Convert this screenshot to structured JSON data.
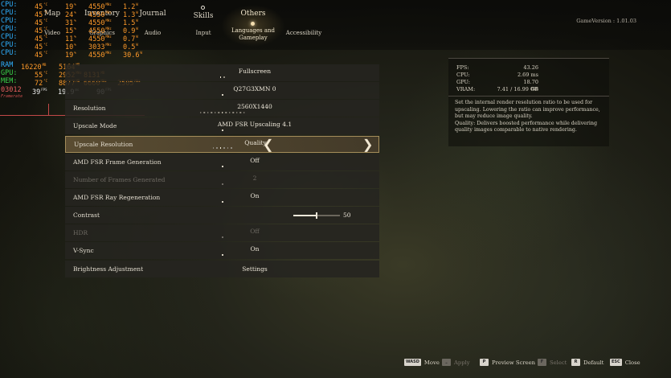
{
  "header": {
    "tabs": [
      "Map",
      "Inventory",
      "Journal",
      "Skills",
      "Others"
    ],
    "subtabs": [
      "Video",
      "Graphics",
      "Audio",
      "Input",
      "Languages and Gameplay",
      "Accessibility"
    ],
    "game_version": "GameVersion : 1.01.03"
  },
  "overlay": {
    "rows": [
      {
        "label": "CPU",
        "temp": "45",
        "load": "19",
        "clock": "4550",
        "power": "1.2"
      },
      {
        "label": "CPU",
        "temp": "45",
        "load": "24",
        "clock": "4550",
        "power": "1.3"
      },
      {
        "label": "CPU",
        "temp": "45",
        "load": "31",
        "clock": "4550",
        "power": "1.5"
      },
      {
        "label": "CPU",
        "temp": "45",
        "load": "15",
        "clock": "4550",
        "power": "0.9"
      },
      {
        "label": "CPU",
        "temp": "45",
        "load": "11",
        "clock": "4550",
        "power": "0.7"
      },
      {
        "label": "CPU",
        "temp": "45",
        "load": "10",
        "clock": "3033",
        "power": "0.5"
      },
      {
        "label": "CPU",
        "temp": "45",
        "load": "19",
        "clock": "4550",
        "power": "30.6"
      }
    ],
    "ram": {
      "label": "RAM",
      "used": "16220",
      "extra": "5164"
    },
    "gpu": {
      "label": "GPU",
      "temp": "55",
      "clock": "2952",
      "mem_clock": "8131"
    },
    "mem": {
      "label": "MEM",
      "temp": "72",
      "used": "8877",
      "clock": "6660",
      "power": "2505"
    },
    "fps_row": {
      "id": "03012",
      "fps1": "39",
      "fps2": "19.9",
      "fps3": "90",
      "frame_label": "Framerate"
    },
    "colors": {
      "label": "#2fb0ff",
      "value": "#ff9a2a",
      "graph": "#c24848"
    }
  },
  "settings": {
    "rows": [
      {
        "label": "",
        "value": "Fullscreen",
        "disabled": false
      },
      {
        "label": "",
        "value": "Q27G3XMN 0",
        "disabled": false
      },
      {
        "label": "Resolution",
        "value": "2560X1440",
        "disabled": false
      },
      {
        "label": "Upscale Mode",
        "value": "AMD FSR Upscaling 4.1",
        "disabled": false
      },
      {
        "label": "Upscale Resolution",
        "value": "Quality",
        "disabled": false,
        "selected": true
      },
      {
        "label": "AMD FSR Frame Generation",
        "value": "Off",
        "disabled": false
      },
      {
        "label": "Number of Frames Generated",
        "value": "2",
        "disabled": true
      },
      {
        "label": "AMD FSR Ray Regeneration",
        "value": "On",
        "disabled": false
      },
      {
        "label": "Contrast",
        "value": "50",
        "disabled": false,
        "slider": 0.5
      },
      {
        "label": "HDR",
        "value": "Off",
        "disabled": true
      },
      {
        "label": "V-Sync",
        "value": "On",
        "disabled": false
      },
      {
        "label": "Brightness Adjustment",
        "value": "Settings",
        "disabled": false
      }
    ],
    "arrows": {
      "left": "❮",
      "right": "❯"
    }
  },
  "info": {
    "metrics": [
      {
        "label": "FPS:",
        "value": "43.26",
        "unit": ""
      },
      {
        "label": "CPU:",
        "value": "2.69",
        "unit": "ms"
      },
      {
        "label": "GPU:",
        "value": "18.70",
        "unit": "ms"
      },
      {
        "label": "VRAM:",
        "value": "7.41 / 16.99",
        "unit": "GB"
      }
    ],
    "description": "Set the internal render resolution ratio to be used for upscaling. Lowering the ratio can improve performance, but may reduce image quality.",
    "description2": "Quality: Delivers boosted performance while delivering quality images comparable to native rendering."
  },
  "hints": [
    {
      "key": "WASD",
      "label": "Move",
      "dim": false
    },
    {
      "key": "⎵",
      "label": "Apply",
      "dim": true
    },
    {
      "key": "P",
      "label": "Preview Screen",
      "dim": false
    },
    {
      "key": "F",
      "label": "Select",
      "dim": true
    },
    {
      "key": "R",
      "label": "Default",
      "dim": false
    },
    {
      "key": "ESC",
      "label": "Close",
      "dim": false
    }
  ]
}
